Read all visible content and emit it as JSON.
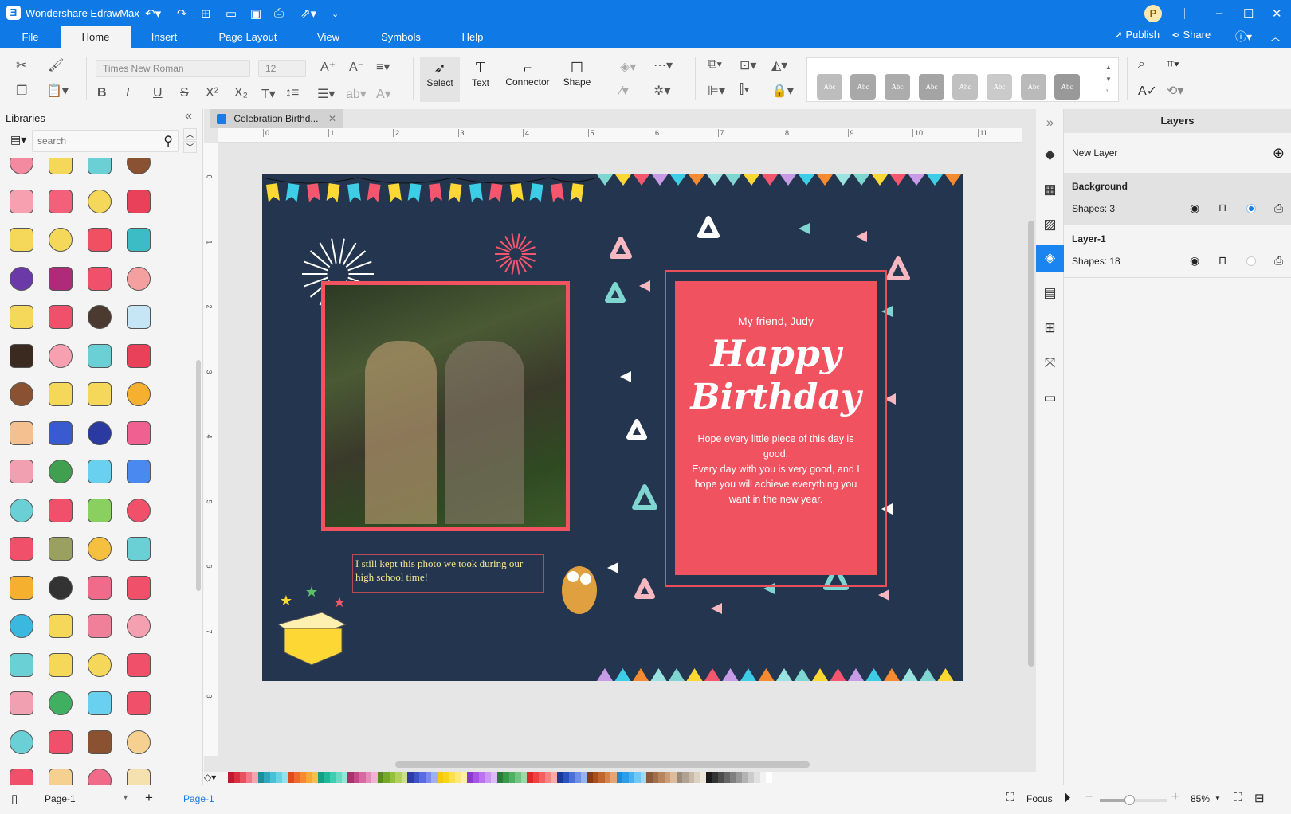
{
  "app": {
    "title": "Wondershare EdrawMax",
    "publish": "Publish",
    "share": "Share",
    "avatar": "P"
  },
  "menu": [
    "File",
    "Home",
    "Insert",
    "Page Layout",
    "View",
    "Symbols",
    "Help"
  ],
  "toolbar": {
    "font": "Times New Roman",
    "size": "12",
    "select": "Select",
    "text": "Text",
    "connector": "Connector",
    "shape": "Shape",
    "style_label": "Abc"
  },
  "libraries": {
    "title": "Libraries",
    "search_placeholder": "search",
    "symbols": [
      [
        "cupcake",
        "#f48aa0"
      ],
      [
        "crown-cake",
        "#f5d75a"
      ],
      [
        "cupcake-blue",
        "#6ad0d6"
      ],
      [
        "teddy-bear",
        "#8a5230"
      ],
      [
        "hbd-heart",
        "#f6a0b0"
      ],
      [
        "heart-balloons",
        "#f3607a"
      ],
      [
        "tulip",
        "#f5d75a"
      ],
      [
        "rose",
        "#e9415a"
      ],
      [
        "cake-stand",
        "#f5d75a"
      ],
      [
        "diamond",
        "#f5d75a"
      ],
      [
        "heart",
        "#ef5062"
      ],
      [
        "camera",
        "#3cbcc4"
      ],
      [
        "wine-glasses",
        "#6b3aa8"
      ],
      [
        "champagne-glasses",
        "#b02a7a"
      ],
      [
        "gift-box",
        "#f0506a"
      ],
      [
        "candle",
        "#f5a0a0"
      ],
      [
        "balloon",
        "#f5d75a"
      ],
      [
        "bunting",
        "#f0506a"
      ],
      [
        "movie-camera",
        "#4a3a30"
      ],
      [
        "toast-glasses",
        "#c6e6f5"
      ],
      [
        "wine-bottle",
        "#3a2a20"
      ],
      [
        "love-letter",
        "#f6a0b0"
      ],
      [
        "envelope",
        "#6ad0d6"
      ],
      [
        "candles",
        "#e9415a"
      ],
      [
        "guitar",
        "#8a5230"
      ],
      [
        "cocktail",
        "#f5d75a"
      ],
      [
        "martini",
        "#f5d75a"
      ],
      [
        "medal",
        "#f5b030"
      ],
      [
        "ice-cream",
        "#f5c090"
      ],
      [
        "mask",
        "#3a5ad0"
      ],
      [
        "mask-dark",
        "#2a3aa0"
      ],
      [
        "donut",
        "#f06090"
      ],
      [
        "sundae",
        "#f0a0b0"
      ],
      [
        "party-hat-green",
        "#40a050"
      ],
      [
        "party-hat-blue",
        "#6ad0f0"
      ],
      [
        "party-hat-stripes",
        "#4a8af0"
      ],
      [
        "party-hat-teal",
        "#6ad0d6"
      ],
      [
        "party-hat-red",
        "#f0506a"
      ],
      [
        "party-hat-lime",
        "#8ad060"
      ],
      [
        "lollipop",
        "#f0506a"
      ],
      [
        "firework-rocket",
        "#f0506a"
      ],
      [
        "surprise-box",
        "#9aa060"
      ],
      [
        "heart-balloon-pair",
        "#f5c040"
      ],
      [
        "magic-wand",
        "#6ad0d6"
      ],
      [
        "wand-star",
        "#f5b030"
      ],
      [
        "donut-dark",
        "#333333"
      ],
      [
        "donut-pink",
        "#f06a8a"
      ],
      [
        "star-red",
        "#f0506a"
      ],
      [
        "star-blue",
        "#3ab8e0"
      ],
      [
        "star-yellow",
        "#f5d75a"
      ],
      [
        "balloons",
        "#f0809a"
      ],
      [
        "crown-pink",
        "#f5a0b0"
      ],
      [
        "crown-teal",
        "#6ad0d6"
      ],
      [
        "mustache",
        "#f5d75a"
      ],
      [
        "gift-yellow",
        "#f5d75a"
      ],
      [
        "glasses",
        "#f0506a"
      ],
      [
        "party-glasses",
        "#f0a0b0"
      ],
      [
        "gift-green",
        "#40b060"
      ],
      [
        "gift-blue",
        "#6ad0f0"
      ],
      [
        "gift-red",
        "#f0506a"
      ],
      [
        "gift-teal",
        "#6ad0d6"
      ],
      [
        "cake-slice",
        "#f0506a"
      ],
      [
        "layer-cake",
        "#8a5230"
      ],
      [
        "cake-candle",
        "#f5d090"
      ],
      [
        "heart-cake",
        "#f0506a"
      ],
      [
        "cake-single",
        "#f5d090"
      ],
      [
        "cake-pink",
        "#f06a8a"
      ],
      [
        "cupcake-cream",
        "#f5e0b0"
      ]
    ]
  },
  "document": {
    "tab": "Celebration Birthd...",
    "ruler": [
      "0",
      "1",
      "2",
      "3",
      "4",
      "5",
      "6",
      "7",
      "8",
      "9",
      "10",
      "11"
    ],
    "vruler": [
      "0",
      "1",
      "2",
      "3",
      "4",
      "5",
      "6",
      "7",
      "8"
    ]
  },
  "card": {
    "greeting": "My friend, Judy",
    "happy": "Happy",
    "birthday": "Birthday",
    "message1": "Hope every little piece of this day is good.",
    "message2": "Every day with you is very good, and I hope you will achieve everything you want in the new year.",
    "caption": "I still kept this photo we took during our high school time!",
    "colors": {
      "background": "#24364f",
      "card": "#f0525f",
      "frame": "#e84f5a"
    }
  },
  "layers": {
    "title": "Layers",
    "new_layer": "New Layer",
    "items": [
      {
        "name": "Background",
        "shapes": "Shapes: 3",
        "active": true
      },
      {
        "name": "Layer-1",
        "shapes": "Shapes: 18",
        "active": false
      }
    ]
  },
  "palette": [
    "#c0192d",
    "#d9303f",
    "#e8505e",
    "#f07a88",
    "#f4a4ae",
    "#1d8da0",
    "#2fa8bd",
    "#46c1d6",
    "#6ad3e3",
    "#94e2ee",
    "#e04a1c",
    "#f06a2c",
    "#f58a30",
    "#f8a838",
    "#f8c048",
    "#13a085",
    "#20b89a",
    "#3fcdb0",
    "#6adac4",
    "#95e6d6",
    "#a8326a",
    "#c8468a",
    "#d868a2",
    "#e48cba",
    "#f0b2d2",
    "#5a8a1c",
    "#76a82a",
    "#94c03c",
    "#b0d25a",
    "#cce08a",
    "#2e3aa8",
    "#3e52c8",
    "#5a6ae0",
    "#7a8af0",
    "#a0aef6",
    "#f8c800",
    "#fad41c",
    "#fce04a",
    "#fde878",
    "#fdf0a8",
    "#8a3ad0",
    "#a852e8",
    "#bc72f0",
    "#cc96f4",
    "#dcbaf8",
    "#2a7a3a",
    "#3a9a4c",
    "#4eb060",
    "#72c482",
    "#9cd8a8",
    "#e02828",
    "#f04040",
    "#f46060",
    "#f68484",
    "#f8aaaa",
    "#1a3a98",
    "#2a52c0",
    "#4a70d8",
    "#6e90e8",
    "#98b2f0",
    "#8a3a10",
    "#a84e1c",
    "#c0662c",
    "#d48448",
    "#e4a474",
    "#1a8ad8",
    "#2a9ee8",
    "#48b2f0",
    "#70c8f4",
    "#9cdaf8",
    "#8a5a3a",
    "#a06e48",
    "#b8865c",
    "#cc9e78",
    "#dcbc9c",
    "#9a8a7a",
    "#b0a290",
    "#c8baa8",
    "#dcd2c2",
    "#ece6da",
    "#1a1a1a",
    "#333333",
    "#4d4d4d",
    "#666666",
    "#808080",
    "#999999",
    "#b3b3b3",
    "#cccccc",
    "#e0e0e0",
    "#f2f2f2",
    "#ffffff"
  ],
  "status": {
    "page_select": "Page-1",
    "page_tab": "Page-1",
    "focus": "Focus",
    "zoom": "85%",
    "zoom_level": 85
  }
}
